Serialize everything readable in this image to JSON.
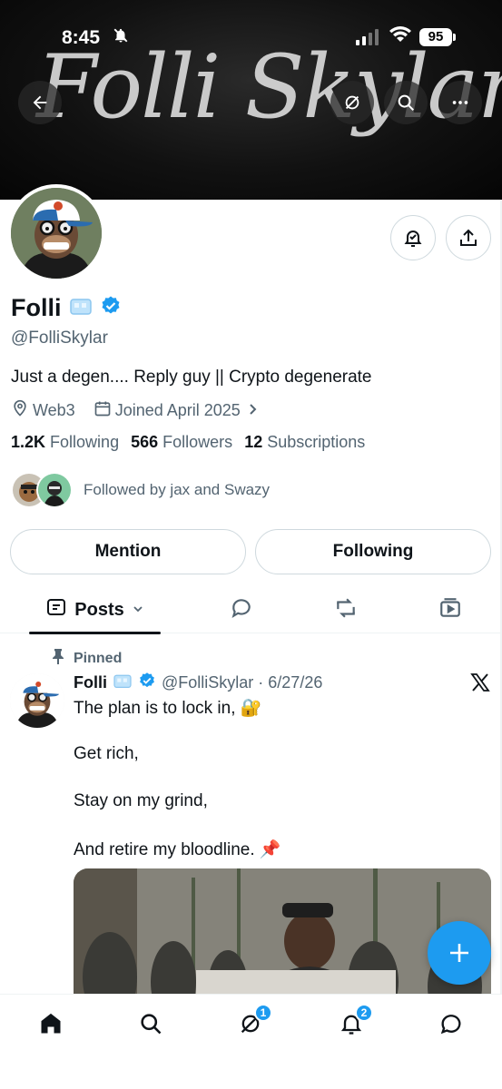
{
  "status_bar": {
    "time": "8:45",
    "battery": "95"
  },
  "banner": {
    "text": "Folli Skylar"
  },
  "profile": {
    "name": "Folli",
    "handle": "@FolliSkylar",
    "bio": "Just a degen.... Reply guy || Crypto degenerate",
    "location": "Web3",
    "joined": "Joined April 2025",
    "following_count": "1.2K",
    "following_label": "Following",
    "followers_count": "566",
    "followers_label": "Followers",
    "subscriptions_count": "12",
    "subscriptions_label": "Subscriptions",
    "followed_by": "Followed by jax and Swazy"
  },
  "actions": {
    "mention": "Mention",
    "following": "Following"
  },
  "tabs": {
    "posts": "Posts"
  },
  "post": {
    "pinned_label": "Pinned",
    "author": "Folli",
    "handle_date": "@FolliSkylar · 6/27/26",
    "line1": "The plan is to lock in, 🔐",
    "line2": "Get rich,",
    "line3": "Stay on my grind,",
    "line4": "And retire my bloodline. 📌"
  },
  "nav": {
    "grok_badge": "1",
    "notifications_badge": "2"
  },
  "colors": {
    "accent": "#1d9bf0",
    "text": "#0f1419",
    "muted": "#536471"
  }
}
